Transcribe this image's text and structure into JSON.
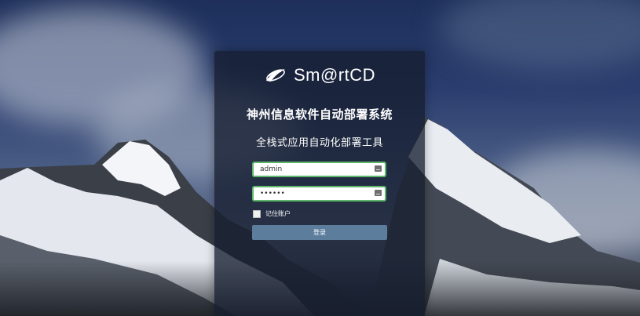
{
  "app": {
    "logo_text": "Sm@rtCD",
    "title": "神州信息软件自动部署系统",
    "subtitle": "全栈式应用自动化部署工具"
  },
  "form": {
    "username_value": "admin",
    "password_value": "••••••",
    "remember_label": "记住账户",
    "remember_checked": false,
    "submit_label": "登录"
  },
  "colors": {
    "panel_bg": "#161e30",
    "field_border": "#5db66a",
    "button_bg": "#5d7d9d"
  },
  "icons": {
    "logo": "smartcd-swoosh-icon",
    "field_action": "keyboard-icon"
  }
}
